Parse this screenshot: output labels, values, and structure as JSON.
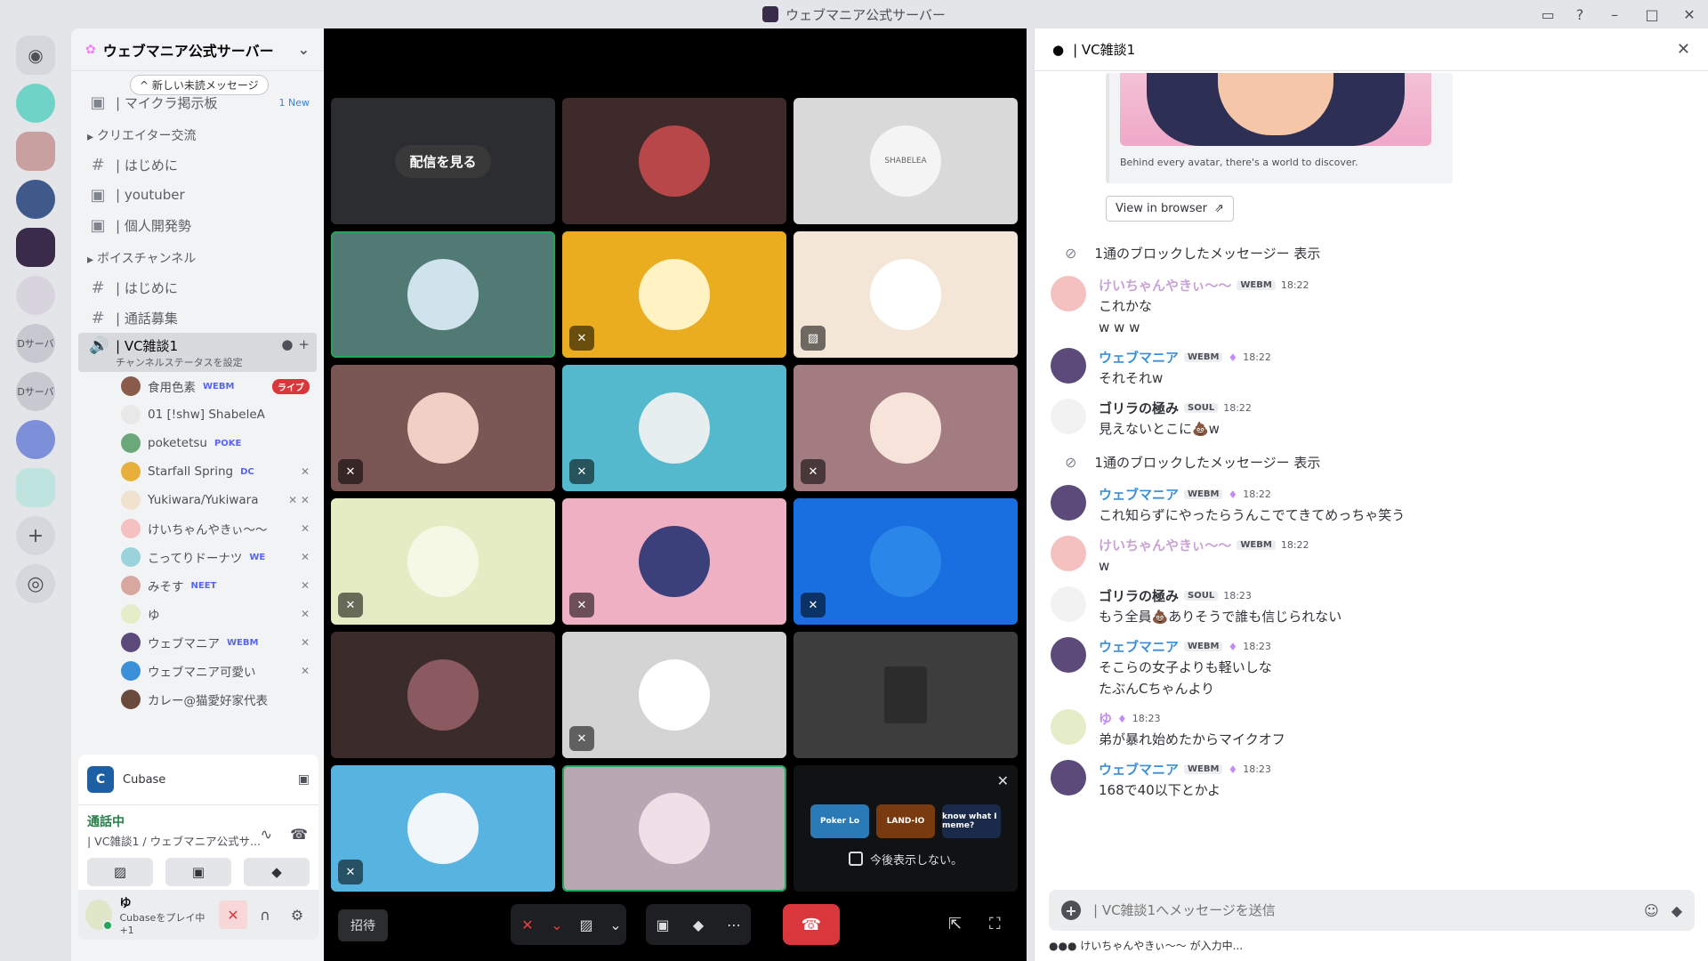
{
  "window": {
    "title": "ウェブマニア公式サーバー"
  },
  "rail": {
    "labels": [
      "Dサーバ",
      "Dサーバ"
    ]
  },
  "sidebar": {
    "server_name": "ウェブマニア公式サーバー",
    "new_messages_pill": "^ 新しい未読メッセージ",
    "top_channel": {
      "name": "| マイクラ掲示板",
      "tag": "1 New"
    },
    "cat_creator": "クリエイター交流",
    "creator_channels": [
      "| はじめに",
      "| youtuber",
      "| 個人開発勢"
    ],
    "cat_voice": "ボイスチャンネル",
    "voice_channels": [
      "| はじめに",
      "| 通話募集"
    ],
    "active_channel": {
      "name": "| VC雑談1",
      "sub": "チャンネルステータスを設定"
    },
    "members": [
      {
        "name": "食用色素",
        "badge": "WEBM",
        "live": "ライブ"
      },
      {
        "name": "01 [!shw] ShabeleA",
        "badge": ""
      },
      {
        "name": "poketetsu",
        "badge": "POKE"
      },
      {
        "name": "Starfall Spring",
        "badge": "DC"
      },
      {
        "name": "Yukiwara/Yukiwara",
        "badge": ""
      },
      {
        "name": "けいちゃんやきぃ～～",
        "badge": ""
      },
      {
        "name": "こってりドーナツ",
        "badge": "WE"
      },
      {
        "name": "みそす",
        "badge": "NEET"
      },
      {
        "name": "ゆ",
        "badge": ""
      },
      {
        "name": "ウェブマニア",
        "badge": "WEBM"
      },
      {
        "name": "ウェブマニア可愛い",
        "badge": ""
      },
      {
        "name": "カレー@猫愛好家代表",
        "badge": ""
      }
    ]
  },
  "panel": {
    "activity_name": "Cubase",
    "voice_status": "通話中",
    "voice_channel": "| VC雑談1 / ウェブマニア公式サ...",
    "user_name": "ゆ",
    "user_activity": "Cubaseをプレイ中 +1"
  },
  "stage": {
    "watch_stream": "配信を見る",
    "tile2_label": "SHABELEA",
    "activity_games": [
      "Poker Lo",
      "LAND-IO",
      "know what I meme?"
    ],
    "dont_show": "今後表示しない。",
    "invite": "招待"
  },
  "chat": {
    "header": "| VC雑談1",
    "embed_caption": "Behind every avatar, there's a world to discover.",
    "view_in_browser": "View in browser",
    "blocked_text": "1通のブロックしたメッセージー 表示",
    "messages": [
      {
        "name": "けいちゃんやきぃ～～",
        "tag": "WEBM",
        "time": "18:22",
        "text": [
          "これかな",
          "w w w"
        ],
        "color": "#c9a3d6"
      },
      {
        "name": "ウェブマニア",
        "tag": "WEBM",
        "time": "18:22",
        "text": [
          "それそれw"
        ],
        "color": "#3b8fd8"
      },
      {
        "name": "ゴリラの極み",
        "tag": "SOUL",
        "time": "18:22",
        "text": [
          "見えないとこに💩w"
        ],
        "color": "#313338"
      },
      {
        "name": "ウェブマニア",
        "tag": "WEBM",
        "time": "18:22",
        "text": [
          "これ知らずにやったらうんこでてきてめっちゃ笑う"
        ],
        "color": "#3b8fd8"
      },
      {
        "name": "けいちゃんやきぃ～～",
        "tag": "WEBM",
        "time": "18:22",
        "text": [
          "w"
        ],
        "color": "#c9a3d6"
      },
      {
        "name": "ゴリラの極み",
        "tag": "SOUL",
        "time": "18:23",
        "text": [
          "もう全員💩ありそうで誰も信じられない"
        ],
        "color": "#313338"
      },
      {
        "name": "ウェブマニア",
        "tag": "WEBM",
        "time": "18:23",
        "text": [
          "そこらの女子よりも軽いしな",
          "たぶんCちゃんより"
        ],
        "color": "#3b8fd8"
      },
      {
        "name": "ゆ",
        "tag": "",
        "time": "18:23",
        "text": [
          "弟が暴れ始めたからマイクオフ"
        ],
        "color": "#c58af9"
      },
      {
        "name": "ウェブマニア",
        "tag": "WEBM",
        "time": "18:23",
        "text": [
          "168で40以下とかよ"
        ],
        "color": "#3b8fd8"
      }
    ],
    "composer_placeholder": "| VC雑談1へメッセージを送信",
    "typing": "けいちゃんやきぃ～～ が入力中..."
  }
}
